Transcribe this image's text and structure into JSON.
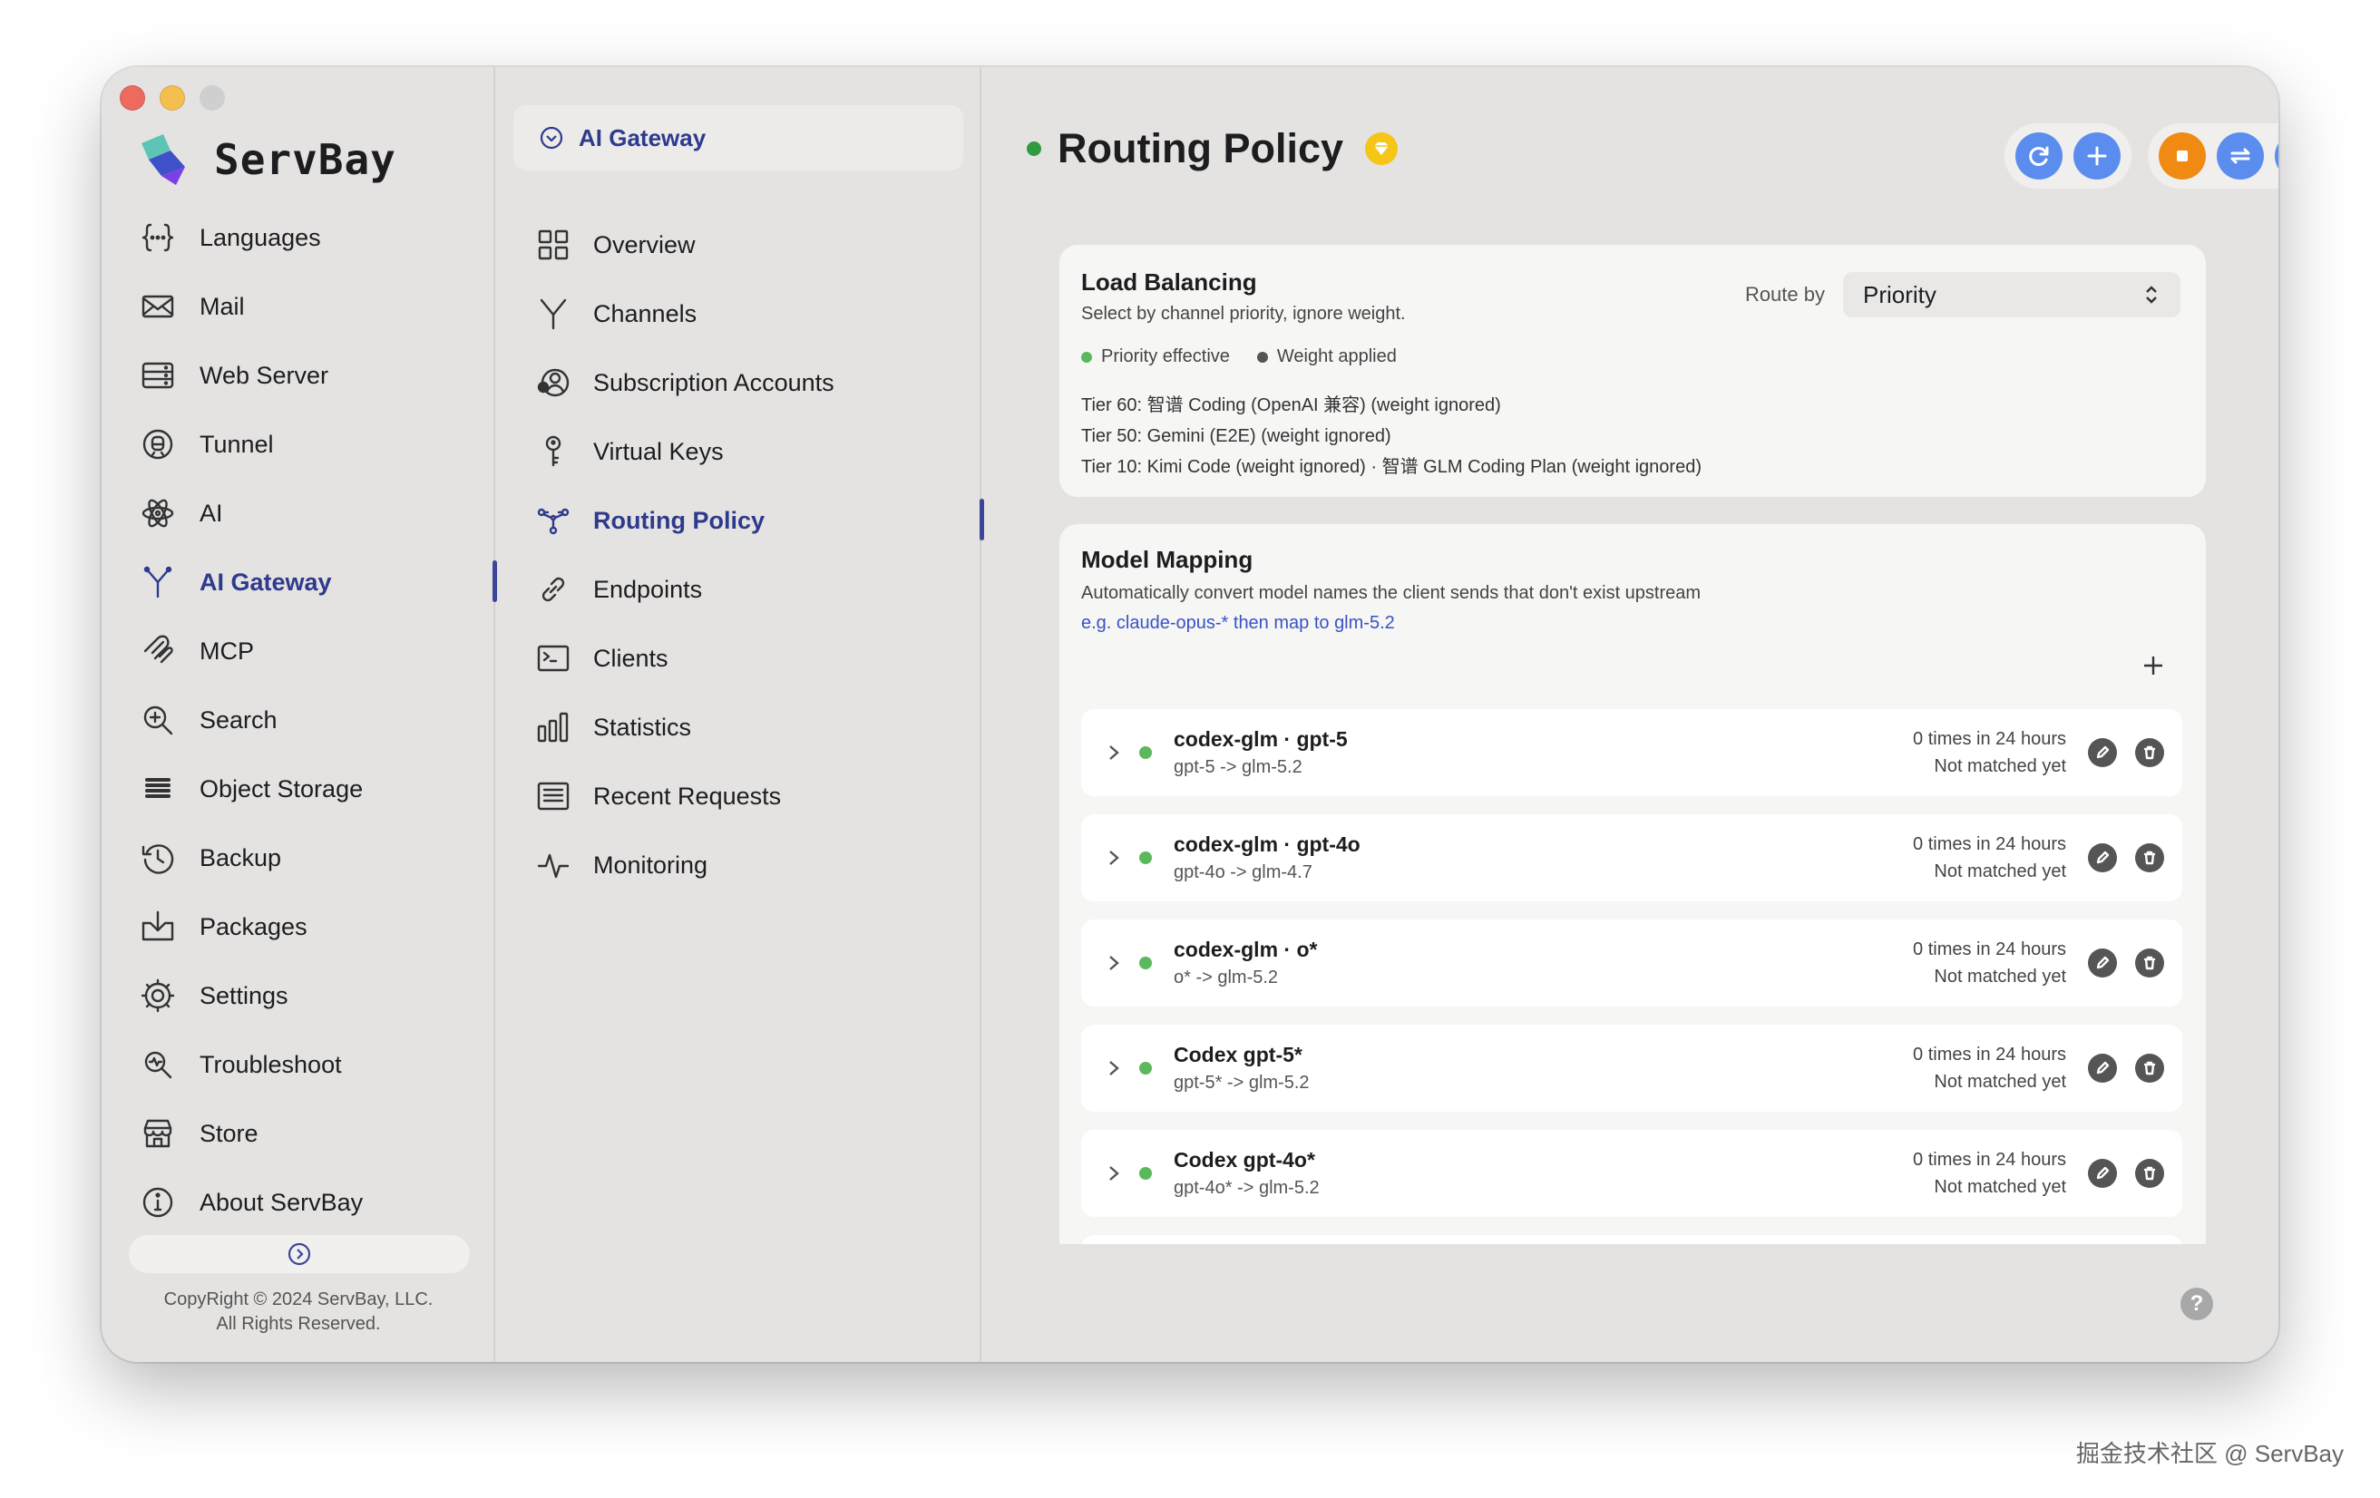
{
  "brand": {
    "name": "ServBay"
  },
  "sidebar": {
    "items": [
      {
        "label": "Languages",
        "icon": "braces-icon"
      },
      {
        "label": "Mail",
        "icon": "mail-icon"
      },
      {
        "label": "Web Server",
        "icon": "server-icon"
      },
      {
        "label": "Tunnel",
        "icon": "tunnel-icon"
      },
      {
        "label": "AI",
        "icon": "atom-icon"
      },
      {
        "label": "AI Gateway",
        "icon": "gateway-icon",
        "active": true
      },
      {
        "label": "MCP",
        "icon": "mcp-icon"
      },
      {
        "label": "Search",
        "icon": "search-icon"
      },
      {
        "label": "Object Storage",
        "icon": "storage-icon"
      },
      {
        "label": "Backup",
        "icon": "backup-icon"
      },
      {
        "label": "Packages",
        "icon": "packages-icon"
      },
      {
        "label": "Settings",
        "icon": "gear-icon"
      },
      {
        "label": "Troubleshoot",
        "icon": "troubleshoot-icon"
      },
      {
        "label": "Store",
        "icon": "store-icon"
      },
      {
        "label": "About ServBay",
        "icon": "info-icon"
      }
    ],
    "copyright_line1": "CopyRight © 2024 ServBay, LLC.",
    "copyright_line2": "All Rights Reserved."
  },
  "submenu": {
    "header": "AI Gateway",
    "items": [
      {
        "label": "Overview",
        "icon": "grid-icon"
      },
      {
        "label": "Channels",
        "icon": "fork-icon"
      },
      {
        "label": "Subscription Accounts",
        "icon": "accounts-icon"
      },
      {
        "label": "Virtual Keys",
        "icon": "key-icon"
      },
      {
        "label": "Routing Policy",
        "icon": "routing-icon",
        "active": true
      },
      {
        "label": "Endpoints",
        "icon": "link-icon"
      },
      {
        "label": "Clients",
        "icon": "terminal-icon"
      },
      {
        "label": "Statistics",
        "icon": "bar-chart-icon"
      },
      {
        "label": "Recent Requests",
        "icon": "list-icon"
      },
      {
        "label": "Monitoring",
        "icon": "pulse-icon"
      }
    ]
  },
  "main": {
    "title": "Routing Policy",
    "load_balancing": {
      "title": "Load Balancing",
      "subtitle": "Select by channel priority, ignore weight.",
      "route_by_label": "Route by",
      "route_by_value": "Priority",
      "legend": [
        {
          "label": "Priority effective",
          "color": "#5cb85c"
        },
        {
          "label": "Weight applied",
          "color": "#555555"
        }
      ],
      "tiers": [
        "Tier 60: 智谱 Coding (OpenAI 兼容) (weight ignored)",
        "Tier 50: Gemini (E2E) (weight ignored)",
        "Tier 10: Kimi Code (weight ignored) · 智谱 GLM Coding Plan (weight ignored)"
      ]
    },
    "model_mapping": {
      "title": "Model Mapping",
      "subtitle": "Automatically convert model names the client sends that don't exist upstream",
      "example": "e.g. claude-opus-* then map to glm-5.2",
      "rows": [
        {
          "name": "codex-glm · gpt-5",
          "mapping": "gpt-5 -> glm-5.2",
          "count": "0 times in 24 hours",
          "status": "Not matched yet"
        },
        {
          "name": "codex-glm · gpt-4o",
          "mapping": "gpt-4o -> glm-4.7",
          "count": "0 times in 24 hours",
          "status": "Not matched yet"
        },
        {
          "name": "codex-glm · o*",
          "mapping": "o* -> glm-5.2",
          "count": "0 times in 24 hours",
          "status": "Not matched yet"
        },
        {
          "name": "Codex gpt-5*",
          "mapping": "gpt-5* -> glm-5.2",
          "count": "0 times in 24 hours",
          "status": "Not matched yet"
        },
        {
          "name": "Codex gpt-4o*",
          "mapping": "gpt-4o* -> glm-5.2",
          "count": "0 times in 24 hours",
          "status": "Not matched yet"
        }
      ]
    },
    "help": "?"
  },
  "watermark": "掘金技术社区 @ ServBay",
  "colors": {
    "accent": "#2e3a8c",
    "blue_btn": "#5b8def",
    "orange_btn": "#f08a12",
    "status_green": "#5cb85c",
    "badge_yellow": "#f5c518"
  }
}
